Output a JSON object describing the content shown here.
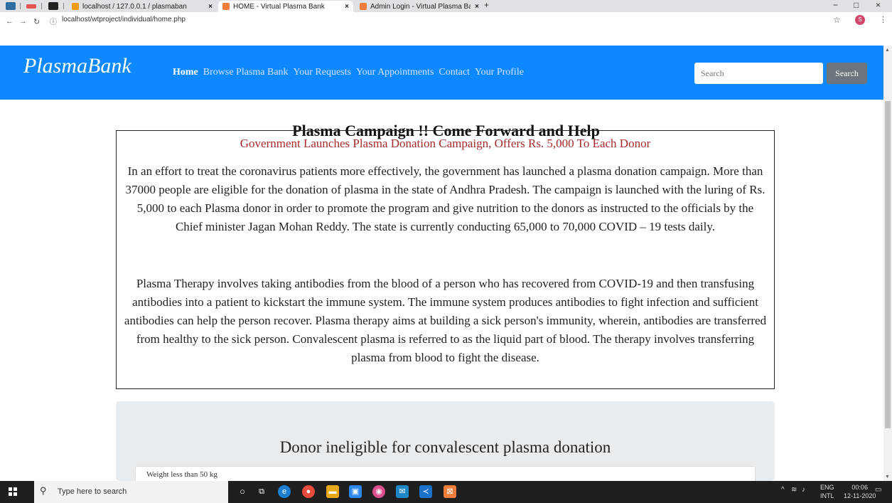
{
  "browser": {
    "tabs": [
      {
        "title": "localhost / 127.0.0.1 / plasmaban"
      },
      {
        "title": "HOME - Virtual Plasma Bank"
      },
      {
        "title": "Admin Login - Virtual Plasma Ba"
      }
    ],
    "url": "localhost/wtproject/individual/home.php",
    "profile_initial": "S"
  },
  "navbar": {
    "brand": "PlasmaBank",
    "links": [
      "Home",
      "Browse Plasma Bank",
      "Your Requests",
      "Your Appointments",
      "Contact",
      "Your Profile"
    ],
    "search_placeholder": "Search",
    "search_button": "Search",
    "color": "#0d88ff"
  },
  "content": {
    "title": "Plasma Campaign !! Come Forward and Help",
    "headline": "Government Launches Plasma Donation Campaign, Offers Rs. 5,000 To Each Donor",
    "paragraph1": "In an effort to treat the coronavirus patients more effectively, the government has launched a plasma donation campaign. More than 37000 people are eligible for the donation of plasma in the state of Andhra Pradesh. The campaign is launched with the luring of Rs. 5,000 to each Plasma donor in order to promote the program and give nutrition to the donors as instructed to the officials by the Chief minister Jagan Mohan Reddy. The state is currently conducting 65,000 to 70,000 COVID – 19 tests daily.",
    "paragraph2": "Plasma Therapy involves taking antibodies from the blood of a person who has recovered from COVID-19 and then transfusing antibodies into a patient to kickstart the immune system. The immune system produces antibodies to fight infection and sufficient antibodies can help the person recover. Plasma therapy aims at building a sick person's immunity, wherein, antibodies are transferred from healthy to the sick person. Convalescent plasma is referred to as the liquid part of blood. The therapy involves transferring plasma from blood to fight the disease.",
    "ineligible_title": "Donor ineligible for convalescent plasma donation",
    "ineligible_items": [
      "Weight less than 50 kg"
    ]
  },
  "taskbar": {
    "search_placeholder": "Type here to search",
    "lang_top": "ENG",
    "lang_bottom": "INTL",
    "time": "00:06",
    "date": "12-11-2020"
  }
}
